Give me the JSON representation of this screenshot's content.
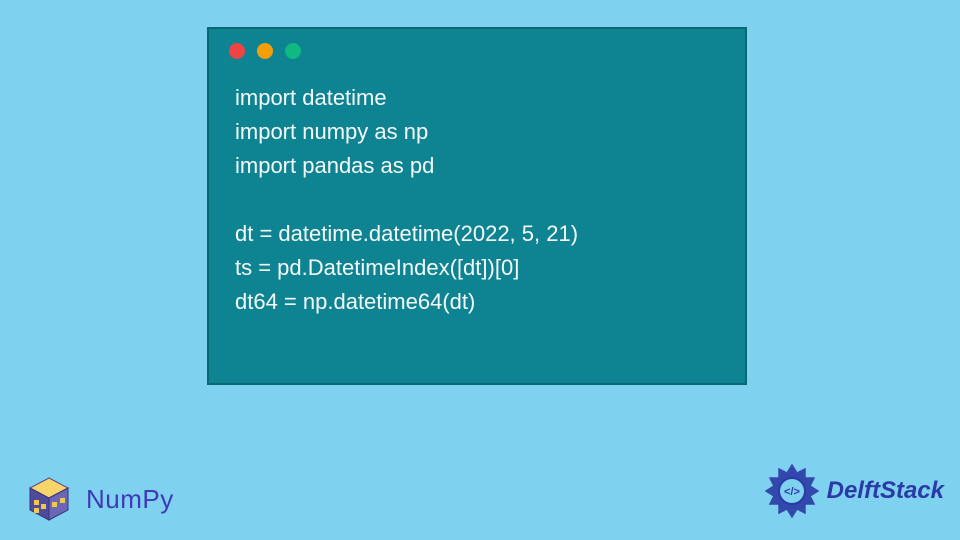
{
  "code": {
    "lines": [
      "import datetime",
      "import numpy as np",
      "import pandas as pd",
      "",
      "dt = datetime.datetime(2022, 5, 21)",
      "ts = pd.DatetimeIndex([dt])[0]",
      "dt64 = np.datetime64(dt)"
    ]
  },
  "logos": {
    "numpy": "NumPy",
    "delft": "DelftStack"
  },
  "colors": {
    "background": "#7fd1f0",
    "windowBg": "#0e8493",
    "numpyBlue": "#3f3ab8",
    "delftBlue": "#2a3aa6"
  }
}
